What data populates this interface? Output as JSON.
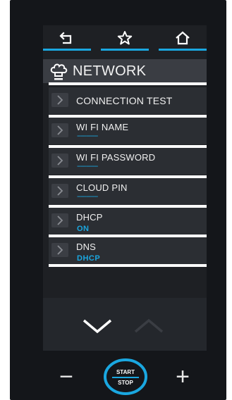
{
  "nav": {
    "back_icon": "back-arrow-icon",
    "favorite_icon": "star-icon",
    "home_icon": "home-icon"
  },
  "header": {
    "icon": "chef-hat-icon",
    "title": "NETWORK"
  },
  "menu": {
    "items": [
      {
        "label": "CONNECTION TEST",
        "value": ""
      },
      {
        "label": "WI FI NAME",
        "value": "-----------"
      },
      {
        "label": "WI FI PASSWORD",
        "value": "-----------"
      },
      {
        "label": "CLOUD PIN",
        "value": "-----------"
      },
      {
        "label": "DHCP",
        "value": "ON"
      },
      {
        "label": "DNS",
        "value": "DHCP"
      }
    ]
  },
  "scroll": {
    "down_icon": "chevron-down-icon",
    "up_icon": "chevron-up-icon"
  },
  "controls": {
    "minus": "−",
    "plus": "+",
    "start_label": "START",
    "stop_label": "STOP"
  },
  "colors": {
    "accent": "#1aa7e0",
    "panel": "#14161a",
    "item_bg": "#2b2e33",
    "header_bg": "#3a3d43"
  }
}
